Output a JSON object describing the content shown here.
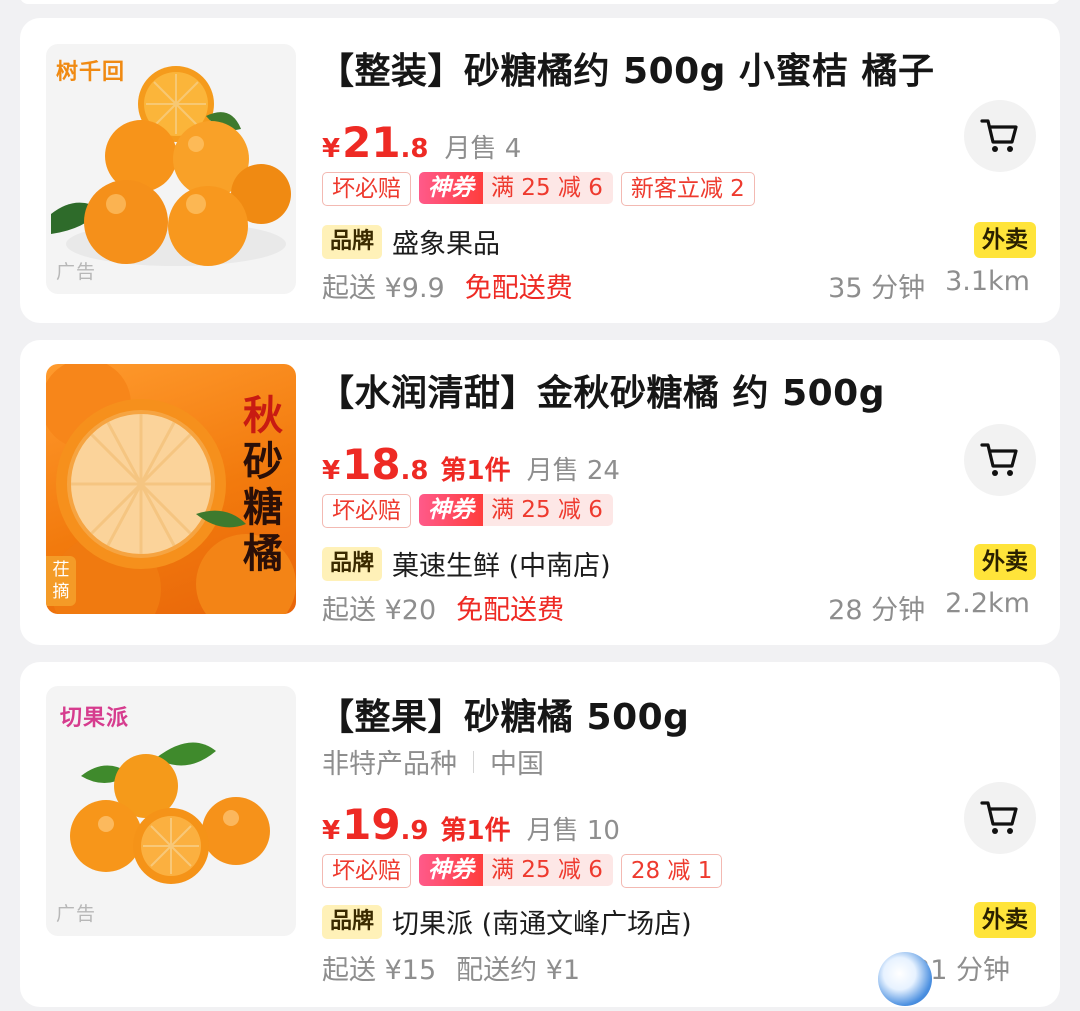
{
  "products": [
    {
      "title": "【整装】砂糖橘约 500g 小蜜桔 橘子",
      "yen": "¥",
      "price_int": "21",
      "price_dec": ".8",
      "first_item": "",
      "monthly_sales": "月售 4",
      "tags": {
        "guarantee": "坏必赔",
        "shen_label": "神券",
        "shen_value": "满 25 减 6",
        "extra": "新客立减 2"
      },
      "brand_tag": "品牌",
      "store": "盛象果品",
      "min_order": "起送 ¥9.9",
      "delivery_fee": "免配送费",
      "eta": "35 分钟",
      "distance": "3.1km",
      "delivery_badge": "外卖",
      "thumb": {
        "logo": "树千回",
        "ad": "广告"
      }
    },
    {
      "title": "【水润清甜】金秋砂糖橘 约 500g",
      "yen": "¥",
      "price_int": "18",
      "price_dec": ".8",
      "first_item": "第1件",
      "monthly_sales": "月售 24",
      "tags": {
        "guarantee": "坏必赔",
        "shen_label": "神券",
        "shen_value": "满 25 减 6",
        "extra": ""
      },
      "brand_tag": "品牌",
      "store": "菓速生鲜 (中南店)",
      "min_order": "起送 ¥20",
      "delivery_fee": "免配送费",
      "eta": "28 分钟",
      "distance": "2.2km",
      "delivery_badge": "外卖",
      "thumb": {
        "vertical_first": "秋",
        "vertical_rest": "砂糖橘",
        "badge": "茌摘"
      }
    },
    {
      "title": "【整果】砂糖橘 500g",
      "origin": [
        "非特产品种",
        "中国"
      ],
      "yen": "¥",
      "price_int": "19",
      "price_dec": ".9",
      "first_item": "第1件",
      "monthly_sales": "月售 10",
      "tags": {
        "guarantee": "坏必赔",
        "shen_label": "神券",
        "shen_value": "满 25 减 6",
        "extra": "28 减 1"
      },
      "brand_tag": "品牌",
      "store": "切果派 (南通文峰广场店)",
      "min_order": "起送 ¥15",
      "delivery_fee": "配送约 ¥1",
      "eta": "31 分钟",
      "distance": "",
      "delivery_badge": "外卖",
      "thumb": {
        "logo": "切果派",
        "ad": "广告"
      }
    }
  ],
  "colors": {
    "price": "#ee2a24",
    "badge_yellow": "#ffe43a",
    "brand_bg": "#fff1b8"
  },
  "icons": {
    "cart": "cart-icon"
  }
}
